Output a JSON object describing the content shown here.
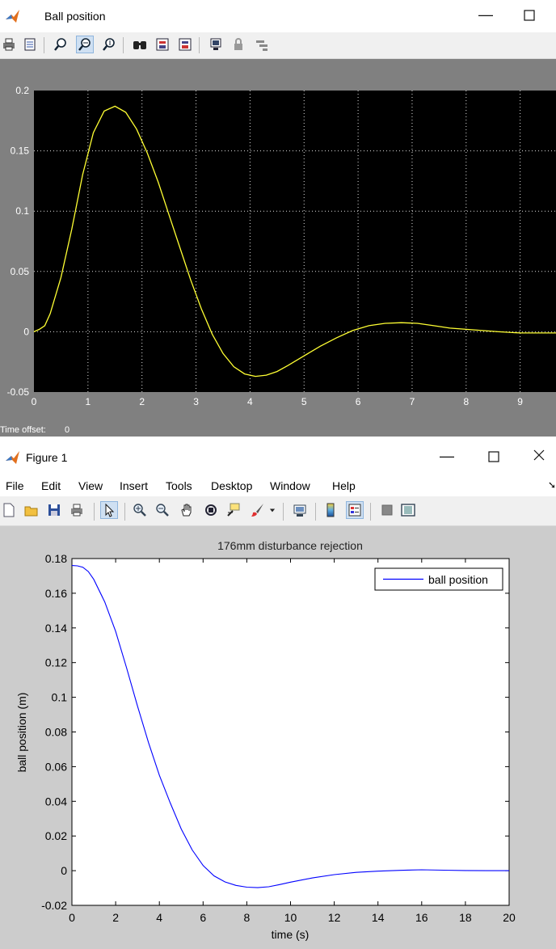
{
  "scope_window": {
    "title": "Ball position",
    "footer_label": "Time offset:",
    "footer_value": "0",
    "colors": {
      "frame": "#808080",
      "axes_bg": "#000000",
      "trace": "#ffff33",
      "grid": "#e0e0e0"
    },
    "toolbar_icons": [
      "print-icon",
      "parameters-icon",
      "zoom-icon",
      "zoom-x-icon",
      "zoom-y-icon",
      "autoscale-icon",
      "save-axes-icon",
      "restore-axes-icon",
      "floating-scope-icon",
      "lock-axes-icon",
      "signal-selection-icon"
    ]
  },
  "figure_window": {
    "title": "Figure 1",
    "menu": [
      "File",
      "Edit",
      "View",
      "Insert",
      "Tools",
      "Desktop",
      "Window",
      "Help"
    ],
    "colors": {
      "frame": "#cccccc",
      "axes_bg": "#ffffff",
      "line": "#0000ff"
    },
    "toolbar_icons": [
      "new-figure-icon",
      "open-file-icon",
      "save-icon",
      "print-icon",
      "edit-plot-icon",
      "zoom-in-icon",
      "zoom-out-icon",
      "pan-icon",
      "rotate-3d-icon",
      "data-cursor-icon",
      "brush-icon",
      "link-plot-icon",
      "colorbar-icon",
      "legend-icon",
      "hide-plot-tools-icon",
      "show-plot-tools-icon"
    ]
  },
  "chart_data": [
    {
      "type": "line",
      "ylim": [
        -0.05,
        0.2
      ],
      "xlim": [
        0,
        10
      ],
      "xticks": [
        "0",
        "1",
        "2",
        "3",
        "4",
        "5",
        "6",
        "7",
        "8",
        "9"
      ],
      "yticks": [
        "-0.05",
        "0",
        "0.05",
        "0.1",
        "0.15",
        "0.2"
      ],
      "grid": true,
      "series": [
        {
          "x": [
            0,
            0.1,
            0.2,
            0.3,
            0.5,
            0.7,
            0.9,
            1.1,
            1.3,
            1.5,
            1.7,
            1.9,
            2.1,
            2.3,
            2.5,
            2.7,
            2.9,
            3.1,
            3.3,
            3.5,
            3.7,
            3.9,
            4.1,
            4.3,
            4.5,
            4.7,
            5.0,
            5.3,
            5.6,
            5.9,
            6.2,
            6.5,
            6.8,
            7.1,
            7.4,
            7.7,
            8.0,
            8.3,
            8.6,
            9.0,
            9.4,
            9.8,
            10.2
          ],
          "y": [
            0,
            0.002,
            0.005,
            0.015,
            0.045,
            0.085,
            0.13,
            0.165,
            0.183,
            0.187,
            0.182,
            0.168,
            0.148,
            0.124,
            0.097,
            0.07,
            0.043,
            0.019,
            -0.002,
            -0.018,
            -0.029,
            -0.035,
            -0.037,
            -0.036,
            -0.033,
            -0.028,
            -0.02,
            -0.012,
            -0.005,
            0.001,
            0.005,
            0.007,
            0.0075,
            0.007,
            0.005,
            0.003,
            0.002,
            0.001,
            0,
            -0.001,
            -0.001,
            -0.001,
            -0.001
          ]
        }
      ]
    },
    {
      "type": "line",
      "title": "176mm disturbance rejection",
      "xlabel": "time (s)",
      "ylabel": "ball position (m)",
      "xlim": [
        0,
        20
      ],
      "ylim": [
        -0.02,
        0.18
      ],
      "xticks": [
        "0",
        "2",
        "4",
        "6",
        "8",
        "10",
        "12",
        "14",
        "16",
        "18",
        "20"
      ],
      "yticks": [
        "-0.02",
        "0",
        "0.02",
        "0.04",
        "0.06",
        "0.08",
        "0.1",
        "0.12",
        "0.14",
        "0.16",
        "0.18"
      ],
      "grid": false,
      "legend": "top-right",
      "series": [
        {
          "name": "ball position",
          "x": [
            0,
            0.25,
            0.5,
            0.75,
            1,
            1.5,
            2,
            2.5,
            3,
            3.5,
            4,
            4.5,
            5,
            5.5,
            6,
            6.5,
            7,
            7.5,
            8,
            8.5,
            9,
            9.5,
            10,
            11,
            12,
            13,
            14,
            15,
            16,
            17,
            18,
            19,
            20
          ],
          "y": [
            0.176,
            0.1758,
            0.175,
            0.1725,
            0.168,
            0.155,
            0.138,
            0.117,
            0.095,
            0.074,
            0.055,
            0.039,
            0.024,
            0.012,
            0.003,
            -0.003,
            -0.0065,
            -0.0085,
            -0.0095,
            -0.0098,
            -0.0093,
            -0.008,
            -0.0066,
            -0.0042,
            -0.0023,
            -0.001,
            -0.0003,
            0.0002,
            0.0005,
            0.0003,
            0.0001,
            0,
            0
          ]
        }
      ]
    }
  ]
}
